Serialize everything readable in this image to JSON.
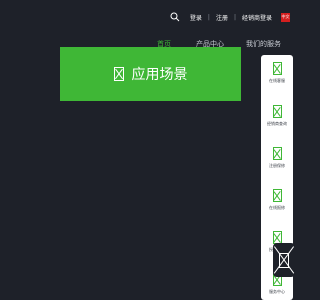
{
  "header": {
    "login": "登录",
    "register": "注册",
    "dealer_login": "经销商登录",
    "separator": "|",
    "flag_text": "中文"
  },
  "nav": {
    "items": [
      "首页",
      "产品中心",
      "我们的服务"
    ]
  },
  "hero": {
    "title": "应用场景"
  },
  "side_panel": {
    "items": [
      "在线客服",
      "经销商查询",
      "注册保修",
      "在线报修",
      "授权查询",
      "服务中心"
    ]
  },
  "colors": {
    "accent": "#3fb736",
    "background": "#1e2129",
    "flag": "#d41f1f"
  },
  "icons": [
    "search-icon",
    "image-placeholder-icon"
  ]
}
